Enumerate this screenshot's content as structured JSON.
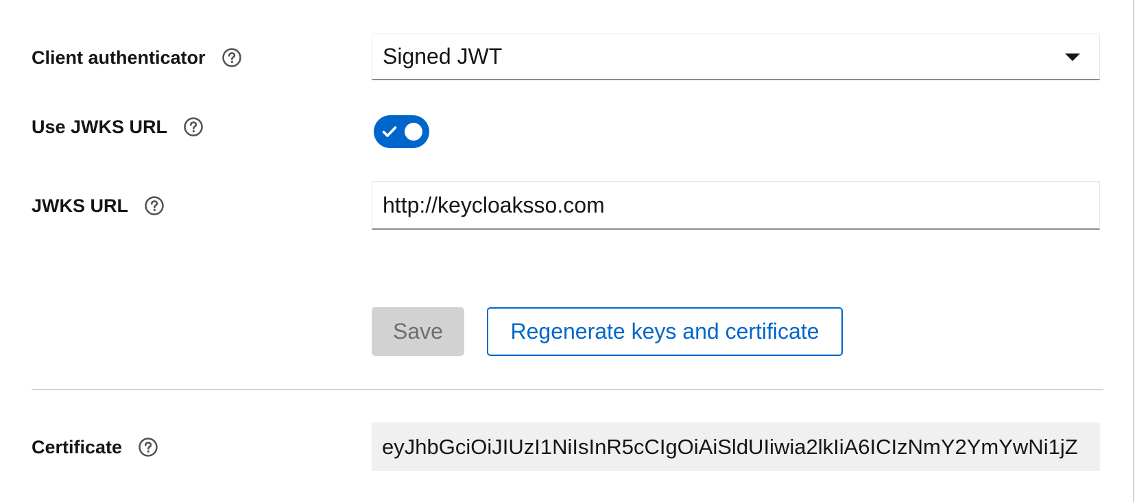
{
  "form": {
    "client_authenticator": {
      "label": "Client authenticator",
      "value": "Signed JWT",
      "help_icon": "help-circle-icon"
    },
    "use_jwks_url": {
      "label": "Use JWKS URL",
      "enabled": true,
      "help_icon": "help-circle-icon"
    },
    "jwks_url": {
      "label": "JWKS URL",
      "value": "http://keycloaksso.com",
      "help_icon": "help-circle-icon"
    },
    "buttons": {
      "save_label": "Save",
      "regenerate_label": "Regenerate keys and certificate"
    },
    "certificate": {
      "label": "Certificate",
      "value": "eyJhbGciOiJIUzI1NiIsInR5cCIgOiAiSldUIiwia2lkIiA6ICIzNmY2YmYwNi1jZ",
      "help_icon": "help-circle-icon"
    }
  },
  "colors": {
    "accent": "#0066cc",
    "disabled_bg": "#d2d2d2",
    "disabled_text": "#6a6e73",
    "readonly_bg": "#f0f0f0",
    "divider": "#d2d2d2"
  }
}
